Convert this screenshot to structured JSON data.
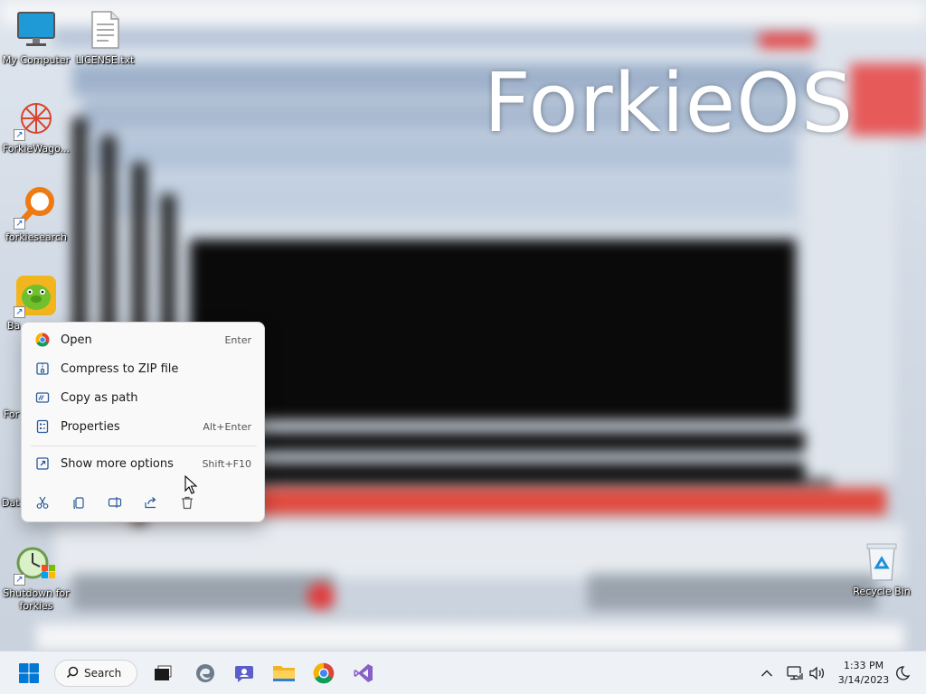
{
  "wallpaper": {
    "title": "ForkieOS"
  },
  "desktop": {
    "icons": [
      {
        "label": "My Computer",
        "icon": "monitor-icon"
      },
      {
        "label": "LICENSE.txt",
        "icon": "text-file-icon"
      },
      {
        "label": "ForkieWago...",
        "icon": "forkiewagon-icon"
      },
      {
        "label": "forkiesearch",
        "icon": "magnifier-icon"
      },
      {
        "label": "Ba",
        "icon": "pig-game-icon"
      },
      {
        "label": "For",
        "icon": "app-icon"
      },
      {
        "label": "Dat",
        "icon": "data-icon"
      },
      {
        "label": "Shutdown for forkies",
        "icon": "shutdown-clock-icon"
      },
      {
        "label": "Recycle Bin",
        "icon": "recycle-bin-icon"
      }
    ]
  },
  "context_menu": {
    "items": [
      {
        "label": "Open",
        "shortcut": "Enter",
        "icon": "chrome-icon"
      },
      {
        "label": "Compress to ZIP file",
        "shortcut": "",
        "icon": "zip-icon"
      },
      {
        "label": "Copy as path",
        "shortcut": "",
        "icon": "copy-path-icon"
      },
      {
        "label": "Properties",
        "shortcut": "Alt+Enter",
        "icon": "properties-icon"
      },
      {
        "label": "Show more options",
        "shortcut": "Shift+F10",
        "icon": "more-options-icon"
      }
    ],
    "quick_actions": [
      "cut-icon",
      "copy-icon",
      "rename-icon",
      "share-icon",
      "delete-icon"
    ]
  },
  "taskbar": {
    "search_label": "Search",
    "apps": [
      "start-icon",
      "task-view-icon",
      "edge-icon",
      "chat-icon",
      "file-explorer-icon",
      "chrome-icon",
      "visual-studio-icon"
    ],
    "clock": {
      "time": "1:33 PM",
      "date": "3/14/2023"
    },
    "tray": [
      "chevron-up-icon",
      "network-icon",
      "volume-icon",
      "notification-icon"
    ]
  },
  "colors": {
    "taskbar_bg": "#eef1f5",
    "menu_bg": "#f9f9f9",
    "accent": "#0067c0"
  }
}
